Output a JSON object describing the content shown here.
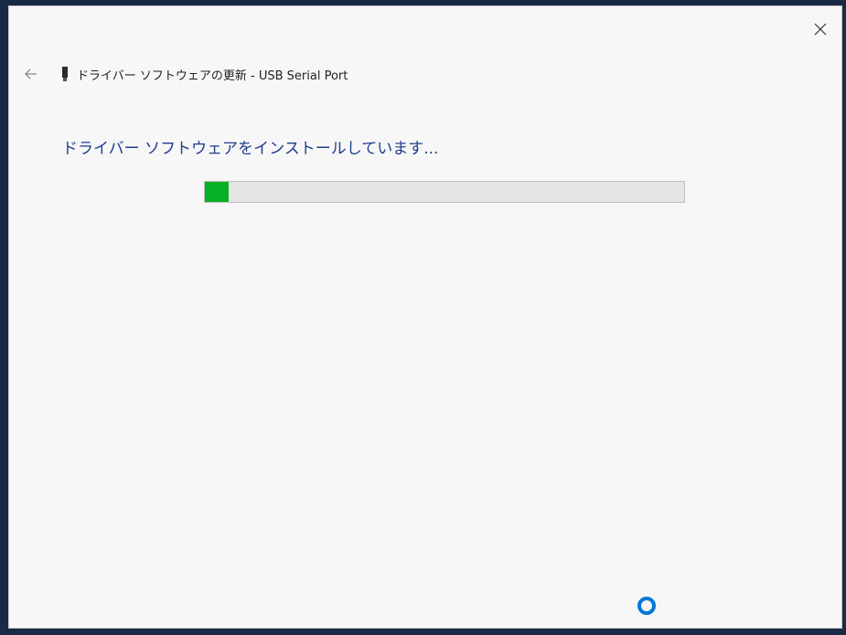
{
  "window": {
    "title": "ドライバー ソフトウェアの更新 - USB Serial Port",
    "heading": "ドライバー ソフトウェアをインストールしています...",
    "close_icon": "close-icon",
    "back_icon": "back-arrow-icon",
    "device_icon": "usb-device-icon"
  },
  "progress": {
    "fraction": 0.05,
    "fill_color": "#06b025",
    "track_color": "#e4e4e4"
  },
  "colors": {
    "heading": "#1e3d8f",
    "accent": "#0078d7"
  },
  "busy_indicator": "loading-spinner-icon"
}
